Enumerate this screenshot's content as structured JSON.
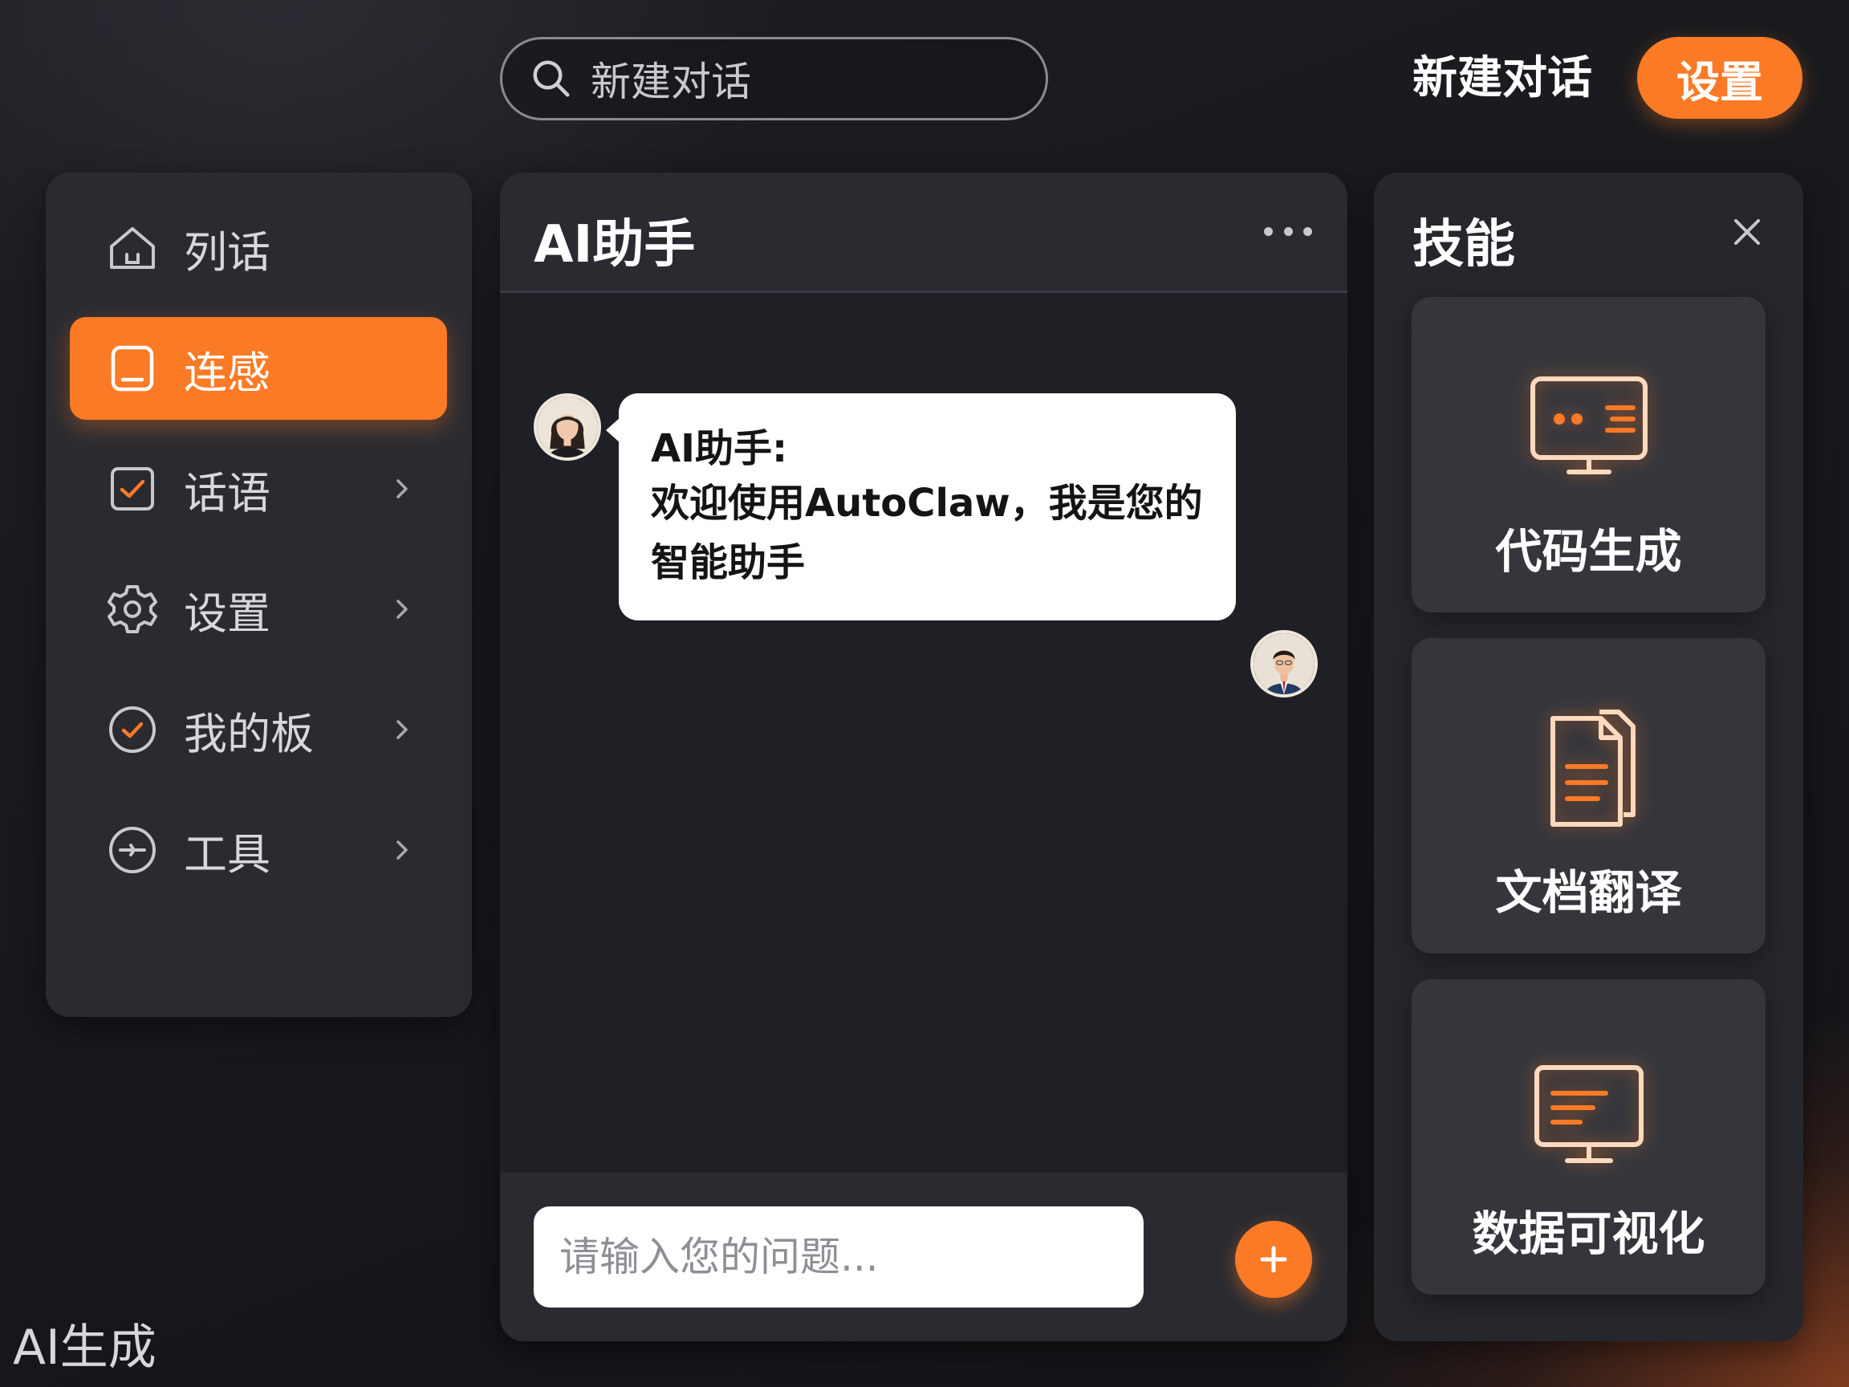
{
  "colors": {
    "accent": "#fb7a26",
    "panel": "#2a2b31",
    "chat_background": "#1f2025",
    "skill_card": "#35363c",
    "bubble": "#ffffff"
  },
  "header": {
    "search": {
      "value": "新建对话",
      "icon": "search-icon"
    },
    "new_chat_label": "新建对话",
    "settings_label": "设置"
  },
  "sidebar": {
    "items": [
      {
        "label": "列话",
        "icon": "home-icon",
        "active": false,
        "has_chevron": false
      },
      {
        "label": "连感",
        "icon": "tablet-icon",
        "active": true,
        "has_chevron": false
      },
      {
        "label": "话语",
        "icon": "checkbox-icon",
        "active": false,
        "has_chevron": true
      },
      {
        "label": "设置",
        "icon": "gear-icon",
        "active": false,
        "has_chevron": true
      },
      {
        "label": "我的板",
        "icon": "check-circle-icon",
        "active": false,
        "has_chevron": true
      },
      {
        "label": "工具",
        "icon": "tool-circle-icon",
        "active": false,
        "has_chevron": true
      }
    ]
  },
  "chat": {
    "title": "AI助手",
    "more_icon": "more-dots-icon",
    "messages": [
      {
        "sender": "AI助手:",
        "text": "欢迎使用AutoClaw，我是您的智能助手"
      }
    ],
    "input": {
      "placeholder": "请输入您的问题..."
    },
    "send_icon": "plus-icon"
  },
  "skills": {
    "title": "技能",
    "close_icon": "close-icon",
    "cards": [
      {
        "label": "代码生成",
        "icon": "code-monitor-icon"
      },
      {
        "label": "文档翻译",
        "icon": "document-icon"
      },
      {
        "label": "数据可视化",
        "icon": "chart-monitor-icon"
      }
    ]
  },
  "watermark": "AI生成"
}
